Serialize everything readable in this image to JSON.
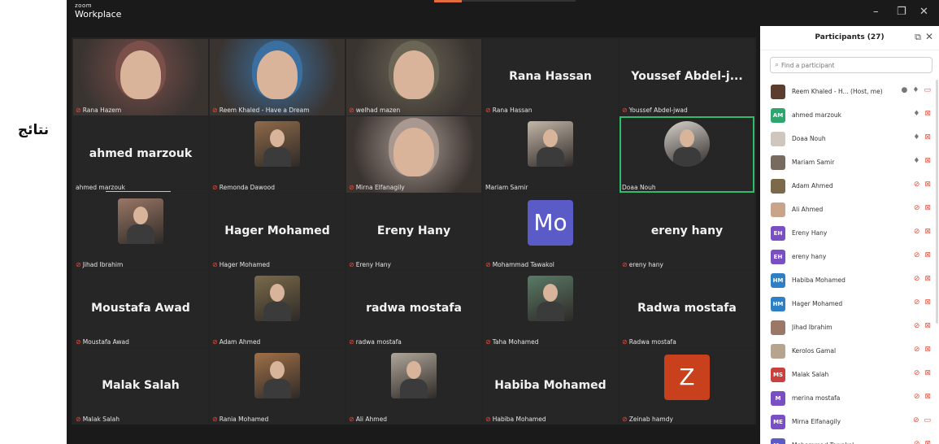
{
  "side_label": "نتائج",
  "window": {
    "brand_small": "zoom",
    "brand_large": "Workplace",
    "minimize": "–",
    "restore": "❐",
    "close": "✕"
  },
  "grid": {
    "tiles": [
      {
        "label": "Rana Hazem",
        "type": "video",
        "tone": "#7b4f4a"
      },
      {
        "label": "Reem Khaled - Have a Dream",
        "type": "video",
        "tone": "#3b6fa0"
      },
      {
        "label": "welhad mazen",
        "type": "video",
        "tone": "#6a6555"
      },
      {
        "big": "Rana Hassan",
        "label": "Rana Hassan",
        "type": "name"
      },
      {
        "big": "Youssef  Abdel-j...",
        "label": "Youssef Abdel-jwad",
        "type": "name"
      },
      {
        "big": "ahmed marzouk",
        "label": "ahmed marzouk",
        "type": "name",
        "no_mic": true,
        "underline": true
      },
      {
        "label": "Remonda Dawood",
        "type": "photo",
        "tone": "#8f6a4a"
      },
      {
        "label": "Mirna Elfanagily",
        "type": "video",
        "tone": "#a89890"
      },
      {
        "label": "Mariam Samir",
        "type": "photo",
        "tone": "#c4b6a8",
        "no_mic": true
      },
      {
        "label": "Doaa Nouh",
        "type": "photo",
        "tone": "#d8d2cc",
        "no_mic": true,
        "active": true
      },
      {
        "label": "Jihad Ibrahim",
        "type": "photo",
        "tone": "#9a7766"
      },
      {
        "big": "Hager Mohamed",
        "label": "Hager Mohamed",
        "type": "name"
      },
      {
        "big": "Ereny Hany",
        "label": "Ereny Hany",
        "type": "name"
      },
      {
        "letter": "Mo",
        "label": "Mohammad Tawakol",
        "type": "letter",
        "color": "#5b5bc8"
      },
      {
        "big": "ereny hany",
        "label": "ereny hany",
        "type": "name"
      },
      {
        "big": "Moustafa Awad",
        "label": "Moustafa Awad",
        "type": "name"
      },
      {
        "label": "Adam Ahmed",
        "type": "photo",
        "tone": "#7a6a4a"
      },
      {
        "big": "radwa mostafa",
        "label": "radwa mostafa",
        "type": "name"
      },
      {
        "label": "Taha Mohamed",
        "type": "photo",
        "tone": "#5a7a66"
      },
      {
        "big": "Radwa mostafa",
        "label": "Radwa mostafa",
        "type": "name"
      },
      {
        "big": "Malak Salah",
        "label": "Malak Salah",
        "type": "name"
      },
      {
        "label": "Rania Mohamed",
        "type": "photo",
        "tone": "#a07048"
      },
      {
        "label": "Ali Ahmed",
        "type": "photo",
        "tone": "#b0a69a"
      },
      {
        "big": "Habiba Mohamed",
        "label": "Habiba Mohamed",
        "type": "name"
      },
      {
        "letter": "Z",
        "label": "Zeinab hamdy",
        "type": "letter",
        "color": "#c9401c"
      }
    ]
  },
  "participants": {
    "title": "Participants (27)",
    "popout_icon": "popout-icon",
    "close": "✕",
    "search_placeholder": "Find a participant",
    "items": [
      {
        "name": "Reem Khaled - H... (Host, me)",
        "avatar": "img",
        "color": "#5a3d2f",
        "icons": [
          "●",
          "🎙",
          "▭"
        ],
        "muted": false,
        "host": true
      },
      {
        "name": "ahmed marzouk",
        "avatar": "AM",
        "color": "#2fa56e",
        "icons": [
          "🎙",
          "⊠"
        ],
        "muted": false
      },
      {
        "name": "Doaa Nouh",
        "avatar": "img",
        "color": "#cfc6bd",
        "icons": [
          "🎙",
          "⊠"
        ],
        "muted": false
      },
      {
        "name": "Mariam Samir",
        "avatar": "img",
        "color": "#776b60",
        "icons": [
          "🎙",
          "⊠"
        ],
        "muted": false
      },
      {
        "name": "Adam Ahmed",
        "avatar": "img",
        "color": "#7a6a4a",
        "icons": [
          "⊘",
          "⊠"
        ],
        "muted": true
      },
      {
        "name": "Ali Ahmed",
        "avatar": "img",
        "color": "#c9a48a",
        "icons": [
          "⊘",
          "⊠"
        ],
        "muted": true
      },
      {
        "name": "Ereny Hany",
        "avatar": "EH",
        "color": "#7a4fc4",
        "icons": [
          "⊘",
          "⊠"
        ],
        "muted": true
      },
      {
        "name": "ereny hany",
        "avatar": "EH",
        "color": "#7a4fc4",
        "icons": [
          "⊘",
          "⊠"
        ],
        "muted": true
      },
      {
        "name": "Habiba Mohamed",
        "avatar": "HM",
        "color": "#2f7fc4",
        "icons": [
          "⊘",
          "⊠"
        ],
        "muted": true
      },
      {
        "name": "Hager Mohamed",
        "avatar": "HM",
        "color": "#2f7fc4",
        "icons": [
          "⊘",
          "⊠"
        ],
        "muted": true
      },
      {
        "name": "Jihad Ibrahim",
        "avatar": "img",
        "color": "#9a7766",
        "icons": [
          "⊘",
          "⊠"
        ],
        "muted": true
      },
      {
        "name": "Kerolos Gamal",
        "avatar": "img",
        "color": "#b6a48e",
        "icons": [
          "⊘",
          "⊠"
        ],
        "muted": true
      },
      {
        "name": "Malak Salah",
        "avatar": "MS",
        "color": "#c9403c",
        "icons": [
          "⊘",
          "⊠"
        ],
        "muted": true
      },
      {
        "name": "merina mostafa",
        "avatar": "M",
        "color": "#7a4fc4",
        "icons": [
          "⊘",
          "⊠"
        ],
        "muted": true
      },
      {
        "name": "Mirna Elfanagily",
        "avatar": "ME",
        "color": "#7a4fc4",
        "icons": [
          "⊘",
          "▭"
        ],
        "muted": true
      },
      {
        "name": "Mohammad Tawakol",
        "avatar": "Mo",
        "color": "#5b5bc8",
        "icons": [
          "⊘",
          "⊠"
        ],
        "muted": true
      }
    ]
  }
}
